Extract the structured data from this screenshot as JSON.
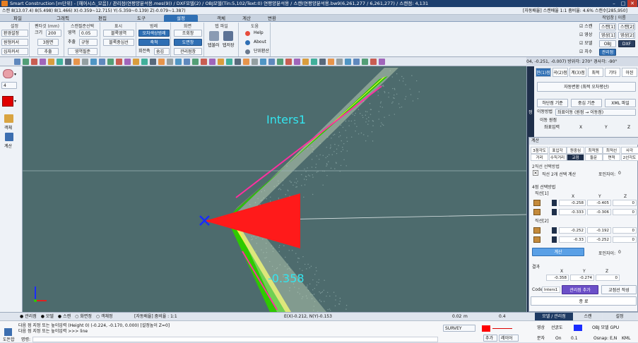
{
  "titlebar": {
    "title": "Smart Construction [m단위] - [헤어시스_모음] / 관리점(연평양분석용.mes(9)) / DXF모델(2) / OBJ모델(Tin:5,102/Text:0) 연평양분석용 / 스캔(연평양분석용.bw9(6,261,277 / 6,261,277) / 스캔점: 4,131",
    "min": "–",
    "max": "□",
    "close": "✕"
  },
  "infobar": {
    "left": "스캔 8(13.07.4) 8(5.498) 8(1.466) X(-0.359~12.715) Y(-5.359~0.139) Z(-0.079~1.387)",
    "right": "[자동배율] 스캔배율 1:1 줌비율: 4.6% 스캔수[285,950]",
    "workspace": "작업창 | 이름"
  },
  "menu_tabs": [
    "파일",
    "그래픽",
    "편집",
    "도구",
    "설정",
    "객체",
    "계산",
    "변환"
  ],
  "ribbon": {
    "g_setting": {
      "title": "설정",
      "env": "환경설정",
      "circle_cursor": "원형커서",
      "cross_cursor": "십자커서"
    },
    "g_pentip": {
      "title": "펜타것 (mm)",
      "size_label": "크기",
      "size_value": "200",
      "three_point": "3점면",
      "extract": "추출"
    },
    "g_scan": {
      "title": "스캔필준선택",
      "area_label": "영역",
      "area_value": "0.05",
      "extract_label": "추출",
      "extract_value": "규형",
      "area_filter": "영역필준"
    },
    "g_display": {
      "title": "표시",
      "block_area": "블록영역",
      "block_center": "블록중심선"
    },
    "g_range": {
      "title": "범례",
      "auto_color": "오차색상범례",
      "axis": "축척",
      "rotation": "회전축",
      "hide": "숨김"
    },
    "g_screen": {
      "title": "화면",
      "inspect": "조회창",
      "drawing": "도면창",
      "manage": "관리점창"
    },
    "g_tabfile": {
      "title": "탭 파일",
      "open": "탭불러",
      "save": "탭저장"
    },
    "g_help": {
      "title": "도움",
      "help": "Help",
      "about": "About",
      "unit": "단위환산"
    },
    "g_view": {
      "rows": [
        {
          "check": "스캔",
          "a": "스캔[1]",
          "b": "스캔[2]"
        },
        {
          "check": "영상",
          "a": "영상[1]",
          "b": "영상[2]"
        },
        {
          "check": "모델",
          "a": "OBJ",
          "b": "DXF"
        },
        {
          "check": "치수",
          "a": "관리점",
          "b": ""
        }
      ]
    }
  },
  "coords": "중심(-0.304, -0.251, -0.007) 방위각: 270° 경사각: -90°",
  "left_panel": {
    "layer_value": "4",
    "object": "객체",
    "calc": "계산"
  },
  "viewport": {
    "label_inters": "Inters1",
    "label_value": "-0.358"
  },
  "right_panel": {
    "tabs": [
      "현(1)점",
      "곡(2)점",
      "계(3)점",
      "최적",
      "기타",
      "아된"
    ],
    "auto_convert": "자동변환 (최적 오차평산)",
    "b1": "하단점 기준",
    "b2": "중심 기준",
    "b3": "XML 파일",
    "move_method_label": "이동방법",
    "move_method_value": "좌표이동 (원점 → 이동점)",
    "move_point": "이동 원점",
    "coord_input": "좌표입력",
    "cols": [
      "X",
      "Y",
      "Z"
    ],
    "side_label": "정"
  },
  "dialog": {
    "title": "계산",
    "tabs_row1": [
      "3점각도",
      "표입각",
      "원중심",
      "최적원",
      "최적선",
      "사각"
    ],
    "tabs_row2": [
      "거리",
      "수직거리",
      "교점",
      "둘문",
      "면적",
      "2선각도"
    ],
    "section1": "2직선 선택방법",
    "two_line_option": "직선 2개 선택 계산",
    "tolerance_label": "포인자이:",
    "tolerance_value": "0",
    "section2": "4점 선택방법",
    "line1_label": "직선[1]",
    "line2_label": "직선[2]",
    "cols": [
      "X",
      "Y",
      "Z"
    ],
    "line1_rows": [
      [
        "-0.258",
        "-0.405",
        "0"
      ],
      [
        "-0.333",
        "-0.306",
        "0"
      ]
    ],
    "line2_rows": [
      [
        "-0.252",
        "-0.192",
        "0"
      ],
      [
        "-0.33",
        "-0.252",
        "0"
      ]
    ],
    "calc_button": "계산",
    "tolerance2_label": "포인자이:",
    "tolerance2_value": "0",
    "result_label": "결과",
    "result_cols": [
      "X",
      "Y",
      "Z"
    ],
    "result_values": [
      "-0.358",
      "-0.274",
      "0"
    ],
    "code_label": "Code",
    "code_value": "Inters1",
    "add_point": "관리점 추가",
    "add_line": "교점선 작성",
    "close": "종 료"
  },
  "statusbar": {
    "radio_items": [
      "관리점",
      "모델",
      "스캔",
      "화면정",
      "객체정"
    ],
    "scale": "[자동배율] 줌비율 : 1:1",
    "cursor": "E(X)-0.212, N(Y)-0.153",
    "value1": "0.02",
    "value1_unit": "m",
    "value2": "0.4",
    "bottom_tabs": [
      "모델 / 관리점",
      "스캔",
      "설정"
    ]
  },
  "cmd": {
    "line1": "다음 점 지정 또는 높이입력 (Height 0) (-0.224, -0.170, 0.000) [설정높이 Z=0]",
    "line2": "다음 점 지정 또는 높이입력 >>> line",
    "prompt_label": "명령:",
    "drawing_label": "도돈합",
    "survey": "SURVEY",
    "add": "추가",
    "layer": "레이어",
    "image": "영상",
    "line_weight": "선굵도",
    "obj_model": "OBJ 모델 GPU",
    "size": "문자",
    "on": "On",
    "val": "0.1",
    "osnap": "Osnap: E,N",
    "kml": "KML"
  },
  "colors": {
    "title": "#1d3f6e",
    "accent": "#2f6fb4",
    "viewport": "#4d6b6d",
    "marker": "#ff1a1a",
    "cross": "#1a2cff",
    "label": "#33e6f0"
  }
}
